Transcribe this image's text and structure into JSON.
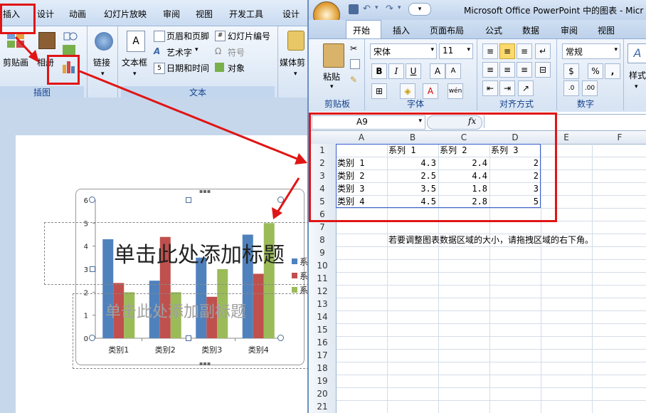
{
  "ppt": {
    "tabs": [
      "插入",
      "设计",
      "动画",
      "幻灯片放映",
      "审阅",
      "视图",
      "开发工具",
      "设计"
    ],
    "ribbon": {
      "clipboard_label": "剪贴画",
      "album_label": "相册",
      "link_label": "链接",
      "textbox_label": "文本框",
      "header_footer": "页眉和页脚",
      "wordart": "艺术字",
      "datetime": "日期和时间",
      "slide_number": "幻灯片编号",
      "symbol": "符号",
      "object": "对象",
      "media_label": "媒体剪",
      "group_illustrations": "插图",
      "group_text": "文本"
    },
    "slide": {
      "title_placeholder": "单击此处添加标题",
      "subtitle_placeholder": "单击此处添加副标题"
    }
  },
  "chart_data": {
    "type": "bar",
    "categories": [
      "类别1",
      "类别2",
      "类别3",
      "类别4"
    ],
    "series": [
      {
        "name": "系列 1",
        "values": [
          4.3,
          2.5,
          3.5,
          4.5
        ],
        "color": "#4f81bd"
      },
      {
        "name": "系列 2",
        "values": [
          2.4,
          4.4,
          1.8,
          2.8
        ],
        "color": "#c0504d"
      },
      {
        "name": "系列 3",
        "values": [
          2,
          2,
          3,
          5
        ],
        "color": "#9bbb59"
      }
    ],
    "y_ticks": [
      "0",
      "1",
      "2",
      "3",
      "4",
      "5",
      "6"
    ],
    "ylim": [
      0,
      6
    ],
    "legend_labels": [
      "系",
      "系",
      "系"
    ],
    "legend_position": "right"
  },
  "excel": {
    "window_title": "Microsoft Office PowerPoint 中的图表 - Micr",
    "tabs": [
      "开始",
      "插入",
      "页面布局",
      "公式",
      "数据",
      "审阅",
      "视图"
    ],
    "ribbon": {
      "paste_label": "粘贴",
      "font_name": "宋体",
      "font_size": "11",
      "number_format": "常规",
      "percent": "%",
      "comma": ",",
      "style_label": "样式",
      "group_clipboard": "剪贴板",
      "group_font": "字体",
      "group_align": "对齐方式",
      "group_number": "数字"
    },
    "name_box": "A9",
    "fx": "fx",
    "columns": [
      "A",
      "B",
      "C",
      "D",
      "E",
      "F"
    ],
    "rows": [
      "1",
      "2",
      "3",
      "4",
      "5",
      "6",
      "7",
      "8",
      "9",
      "10",
      "11",
      "12",
      "13",
      "14",
      "15",
      "16",
      "17",
      "18",
      "19",
      "20",
      "21"
    ],
    "header_row": [
      "",
      "系列 1",
      "系列 2",
      "系列 3"
    ],
    "data_rows": [
      [
        "类别 1",
        "4.3",
        "2.4",
        "2"
      ],
      [
        "类别 2",
        "2.5",
        "4.4",
        "2"
      ],
      [
        "类别 3",
        "3.5",
        "1.8",
        "3"
      ],
      [
        "类别 4",
        "4.5",
        "2.8",
        "5"
      ]
    ],
    "note": "若要调整图表数据区域的大小，请拖拽区域的右下角。"
  }
}
